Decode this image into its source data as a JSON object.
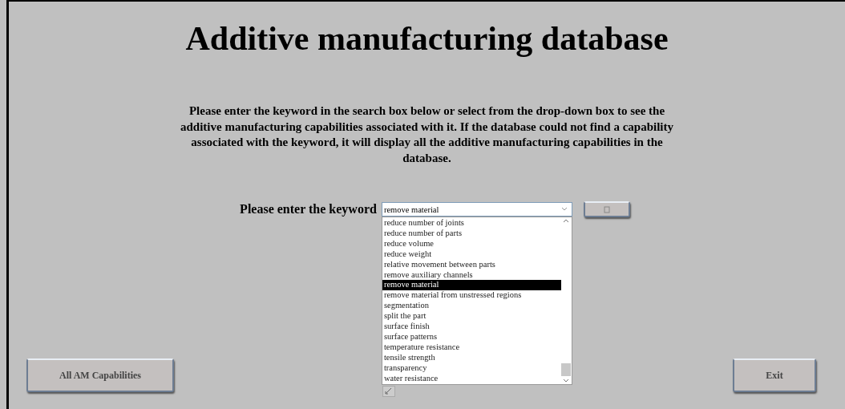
{
  "title": "Additive manufacturing database",
  "instructions": "Please enter the keyword in the search box below or select from the drop-down box to see the additive manufacturing capabilities associated with it. If the database could not find a capability associated with the keyword, it will display all the additive manufacturing capabilities in the database.",
  "keyword_label": "Please enter the keyword",
  "keyword_combo": {
    "value": "remove material",
    "expanded": true
  },
  "options": [
    {
      "label": "reduce number of joints",
      "selected": false
    },
    {
      "label": "reduce number of parts",
      "selected": false
    },
    {
      "label": "reduce volume",
      "selected": false
    },
    {
      "label": "reduce weight",
      "selected": false
    },
    {
      "label": "relative movement between parts",
      "selected": false
    },
    {
      "label": "remove auxiliary channels",
      "selected": false
    },
    {
      "label": "remove material",
      "selected": true
    },
    {
      "label": "remove material from unstressed regions",
      "selected": false
    },
    {
      "label": "segmentation",
      "selected": false
    },
    {
      "label": "split the part",
      "selected": false
    },
    {
      "label": "surface finish",
      "selected": false
    },
    {
      "label": "surface patterns",
      "selected": false
    },
    {
      "label": "temperature resistance",
      "selected": false
    },
    {
      "label": "tensile strength",
      "selected": false
    },
    {
      "label": "transparency",
      "selected": false
    },
    {
      "label": "water resistance",
      "selected": false
    }
  ],
  "buttons": [
    {
      "label": "All AM Capabilities"
    },
    {
      "label": "Exit"
    }
  ]
}
